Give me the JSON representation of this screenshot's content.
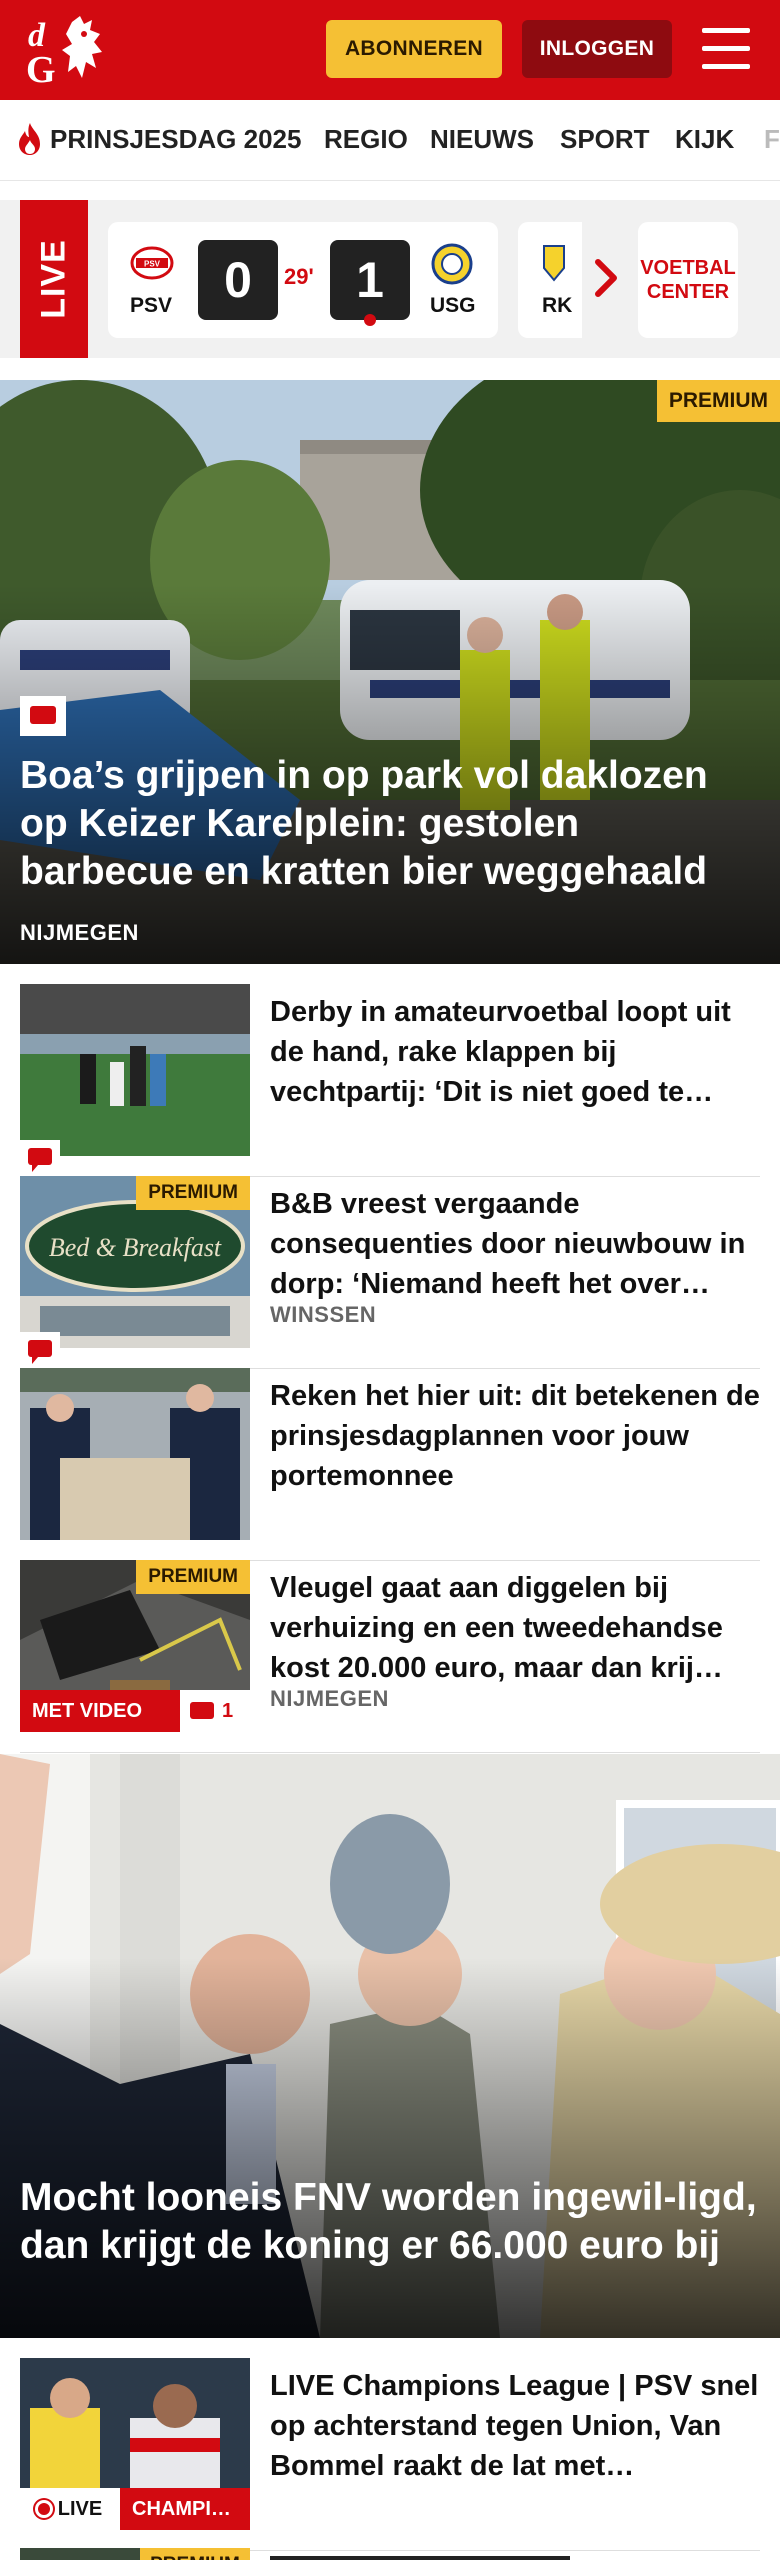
{
  "header": {
    "subscribe_label": "ABONNEREN",
    "login_label": "INLOGGEN",
    "brand_color": "#d20a11",
    "accent_color": "#f5c034"
  },
  "nav": {
    "items": [
      "PRINSJESDAG 2025",
      "REGIO",
      "NIEUWS",
      "SPORT",
      "KIJK",
      "F"
    ]
  },
  "live_bar": {
    "tag": "LIVE",
    "match": {
      "home": "PSV",
      "home_score": "0",
      "minute": "29'",
      "away_score": "1",
      "away": "USG"
    },
    "next_match_club": "RK",
    "voetbalcenter_line1": "VOETBAL",
    "voetbalcenter_line2": "CENTER"
  },
  "hero": {
    "badge": "PREMIUM",
    "title": "Boa’s grijpen in op park vol daklozen op Keizer Karelplein: gestolen barbecue en kratten bier weggehaald",
    "location": "NIJMEGEN"
  },
  "articles": [
    {
      "title": "Derby in amateurvoetbal loopt uit de hand, rake klappen bij vechtpartij: ‘Dit is niet goed te…",
      "location": "",
      "badge": "",
      "comments": ""
    },
    {
      "title": "B&B vreest vergaande consequenties door nieuwbouw in dorp: ‘Niemand heeft het over…",
      "location": "WINSSEN",
      "badge": "PREMIUM",
      "comments": ""
    },
    {
      "title": "Reken het hier uit: dit betekenen de prinsjesdagplannen voor jouw portemonnee",
      "location": "",
      "badge": "",
      "comments": ""
    },
    {
      "title": "Vleugel gaat aan diggelen bij verhuizing en een tweedehandse kost 20.000 euro, maar dan krij…",
      "location": "NIJMEGEN",
      "badge": "PREMIUM",
      "video_label": "MET VIDEO",
      "comments": "1"
    }
  ],
  "hero2": {
    "title": "Mocht looneis FNV worden ingewil-ligd, dan krijgt de koning er 66.000 euro bij"
  },
  "live_article": {
    "title": "LIVE Champions League | PSV snel op achterstand tegen Union, Van Bommel raakt de lat met…",
    "live_label": "LIVE",
    "category": "CHAMPI…"
  },
  "last_article": {
    "badge": "PREMIUM"
  }
}
